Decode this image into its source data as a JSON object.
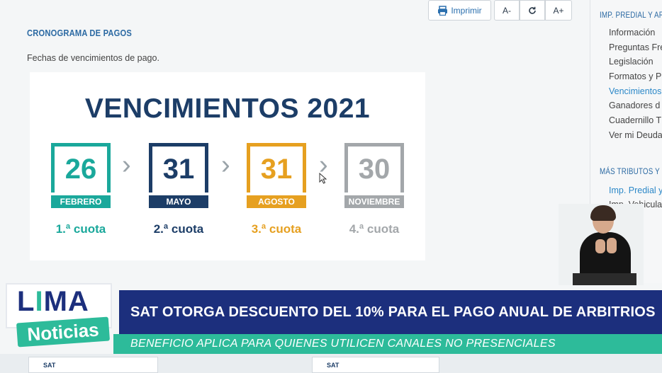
{
  "toolbar": {
    "print_label": "Imprimir",
    "font_decrease": "A-",
    "refresh_icon": "refresh-icon",
    "font_increase": "A+"
  },
  "main": {
    "title": "CRONOGRAMA DE PAGOS",
    "subtitle": "Fechas de vencimientos de pago."
  },
  "banner": {
    "title": "VENCIMIENTOS 2021",
    "dates": [
      {
        "day": "26",
        "month": "FEBRERO",
        "cuota": "1.ª cuota",
        "color": "#1aa89b"
      },
      {
        "day": "31",
        "month": "MAYO",
        "cuota": "2.ª cuota",
        "color": "#1c3d67"
      },
      {
        "day": "31",
        "month": "AGOSTO",
        "cuota": "3.ª cuota",
        "color": "#e6a020"
      },
      {
        "day": "30",
        "month": "NOVIEMBRE",
        "cuota": "4.ª cuota",
        "color": "#a3a7aa"
      }
    ]
  },
  "sidebar": {
    "section1_title": "IMP. PREDIAL Y ARB",
    "section1_items": [
      "Información",
      "Preguntas Fre",
      "Legislación",
      "Formatos y P",
      "Vencimientos",
      "Ganadores d",
      "Cuadernillo T",
      "Ver mi Deuda"
    ],
    "section2_title": "MÁS TRIBUTOS Y MU",
    "section2_items": [
      "Imp. Predial y",
      "Imp. Vehicula"
    ]
  },
  "news": {
    "logo_line1": "LIMA",
    "logo_line2": "Noticias",
    "headline": "SAT OTORGA DESCUENTO DEL 10% PARA EL PAGO ANUAL DE ARBITRIOS",
    "subheadline": "BENEFICIO APLICA PARA QUIENES UTILICEN CANALES NO PRESENCIALES"
  },
  "thumbs": [
    "SAT",
    "SAT"
  ],
  "colors": {
    "accent": "#2c6aa3",
    "headline_bar": "#1c2f7d",
    "sub_bar": "#2dbb9a"
  }
}
